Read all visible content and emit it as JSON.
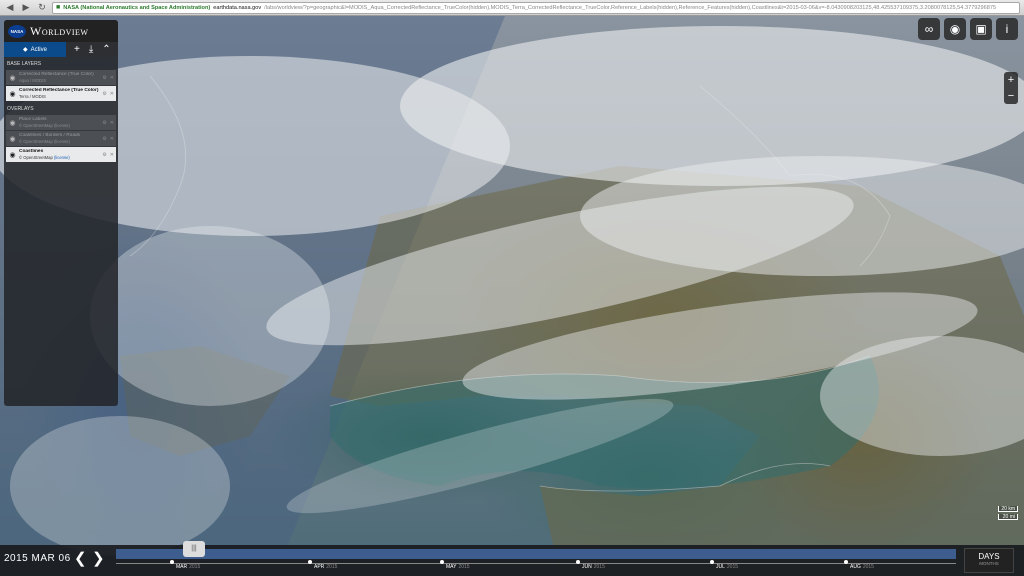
{
  "browser": {
    "secure_label": "NASA (National Aeronautics and Space Administration)",
    "host": "earthdata.nasa.gov",
    "path": "/labs/worldview/?p=geographic&l=MODIS_Aqua_CorrectedReflectance_TrueColor(hidden),MODIS_Terra_CorrectedReflectance_TrueColor,Reference_Labels(hidden),Reference_Features(hidden),Coastlines&t=2015-03-06&v=-8.0430908203125,48.425537109375,3.2080078125,54.3779296875",
    "icons": [
      "back-icon",
      "forward-icon",
      "reload-icon",
      "lock-icon"
    ]
  },
  "app": {
    "logo_text": "NASA",
    "title": "Worldview"
  },
  "panel": {
    "tab_active": "Active",
    "base_layers_heading": "BASE LAYERS",
    "overlays_heading": "OVERLAYS",
    "base_layers": [
      {
        "name": "Corrected Reflectance (True Color)",
        "source": "Aqua / MODIS",
        "visible": false
      },
      {
        "name": "Corrected Reflectance (True Color)",
        "source": "Terra / MODIS",
        "visible": true
      }
    ],
    "overlays": [
      {
        "name": "Place Labels",
        "source": "© OpenStreetMap (license)",
        "visible": false
      },
      {
        "name": "Coastlines / Borders / Roads",
        "source": "© OpenStreetMap (license)",
        "visible": false
      },
      {
        "name": "Coastlines",
        "source": "© OpenStreetMap",
        "license": "(license)",
        "visible": true
      }
    ]
  },
  "map": {
    "controls": [
      "link-icon",
      "globe-icon",
      "camera-icon",
      "info-icon"
    ],
    "zoom_in": "+",
    "zoom_out": "−",
    "scale_km": "20 km",
    "scale_mi": "20 mi"
  },
  "timeline": {
    "date": "2015 MAR 06",
    "prev": "❮",
    "next": "❯",
    "months": [
      {
        "label": "MAR",
        "year": "2015"
      },
      {
        "label": "APR",
        "year": "2015"
      },
      {
        "label": "MAY",
        "year": "2015"
      },
      {
        "label": "JUN",
        "year": "2015"
      },
      {
        "label": "JUL",
        "year": "2015"
      },
      {
        "label": "AUG",
        "year": "2015"
      }
    ],
    "zoom_label": "DAYS",
    "zoom_sub": "MONTHS"
  }
}
